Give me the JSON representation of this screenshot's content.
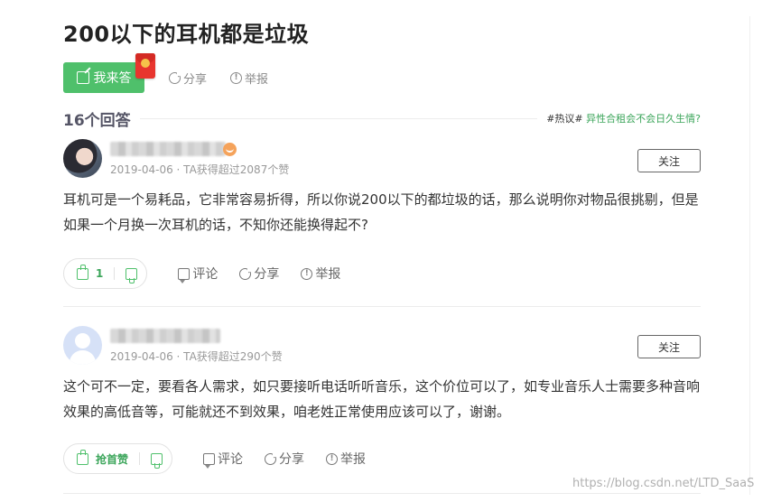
{
  "question": {
    "title": "200以下的耳机都是垃圾",
    "answer_button_label": "我来答",
    "share_label": "分享",
    "report_label": "举报"
  },
  "answers_header": {
    "count_label": "16个回答",
    "hot_tag": "#热议#",
    "hot_topic": "异性合租会不会日久生情?"
  },
  "answers": [
    {
      "meta": "2019-04-06 · TA获得超过2087个赞",
      "follow_label": "关注",
      "text": "耳机可是一个易耗品，它非常容易折得，所以你说200以下的都垃圾的话，那么说明你对物品很挑剔，但是如果一个月换一次耳机的话，不知你还能换得起不?",
      "vote_count": "1",
      "comment_label": "评论",
      "share_label": "分享",
      "report_label": "举报"
    },
    {
      "meta": "2019-04-06 · TA获得超过290个赞",
      "follow_label": "关注",
      "text": "这个可不一定，要看各人需求，如只要接听电话听听音乐，这个价位可以了，如专业音乐人士需要多种音响效果的高低音等，可能就还不到效果，咱老姓正常使用应该可以了，谢谢。",
      "vote_count": "抢首赞",
      "comment_label": "评论",
      "share_label": "分享",
      "report_label": "举报"
    }
  ],
  "watermark": "https://blog.csdn.net/LTD_SaaS",
  "colors": {
    "accent_green": "#4fc06b",
    "link_green": "#3ba55a",
    "red_packet": "#e8352e"
  }
}
